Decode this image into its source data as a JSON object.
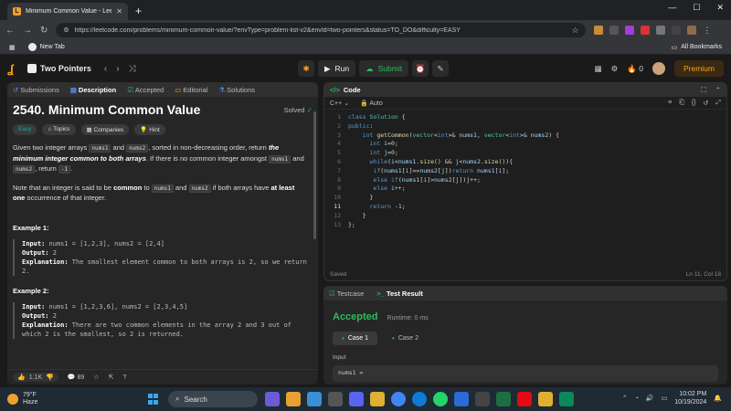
{
  "browser": {
    "tab_title": "Minimum Common Value - Lee",
    "tab_favicon": "L",
    "new_tab_glyph": "+",
    "url": "https://leetcode.com/problems/minimum-common-value/?envType=problem-list-v2&envId=two-pointers&status=TO_DO&difficulty=EASY",
    "bookmark_new_tab": "New Tab",
    "all_bookmarks": "All Bookmarks"
  },
  "lc_nav": {
    "problem_list": "Two Pointers",
    "run": "Run",
    "submit": "Submit",
    "streak": "0",
    "premium": "Premium"
  },
  "left_tabs": {
    "submissions": "Submissions",
    "description": "Description",
    "accepted": "Accepted",
    "editorial": "Editorial",
    "solutions": "Solutions"
  },
  "problem": {
    "title": "2540. Minimum Common Value",
    "solved": "Solved",
    "difficulty": "Easy",
    "chips": [
      "Topics",
      "Companies",
      "Hint"
    ],
    "desc1_a": "Given two integer arrays ",
    "desc1_code1": "nums1",
    "desc1_b": " and ",
    "desc1_code2": "nums2",
    "desc1_c": ", sorted in non-decreasing order, return ",
    "desc1_bold": "the minimum integer common",
    "desc1_d": " to both arrays",
    "desc1_e": ". If there is no common integer amongst ",
    "desc1_code3": "nums1",
    "desc1_f": " and ",
    "desc1_code4": "nums2",
    "desc1_g": ", return ",
    "desc1_code5": "-1",
    "desc1_h": ".",
    "desc2_a": "Note that an integer is said to be ",
    "desc2_bold1": "common",
    "desc2_b": " to ",
    "desc2_code1": "nums1",
    "desc2_c": " and ",
    "desc2_code2": "nums2",
    "desc2_d": " if both arrays have ",
    "desc2_bold2": "at least one",
    "desc2_e": " occurrence of that integer.",
    "examples": [
      {
        "heading": "Example 1:",
        "input": "nums1 = [1,2,3], nums2 = [2,4]",
        "output": "2",
        "explanation": "The smallest element common to both arrays is 2, so we return 2."
      },
      {
        "heading": "Example 2:",
        "input": "nums1 = [1,2,3,6], nums2 = [2,3,4,5]",
        "output": "2",
        "explanation": "There are two common elements in the array 2 and 3 out of which 2 is the smallest, so 2 is returned."
      }
    ],
    "labels": {
      "input": "Input:",
      "output": "Output:",
      "explanation": "Explanation:"
    },
    "likes": "1.1K",
    "comments": "89"
  },
  "code_panel": {
    "title": "Code",
    "language": "C++",
    "auto": "Auto",
    "saved": "Saved",
    "cursor": "Ln 11, Col 18",
    "line_numbers": [
      "1",
      "2",
      "3",
      "4",
      "5",
      "6",
      "7",
      "8",
      "9",
      "10",
      "11",
      "12",
      "13"
    ]
  },
  "test_panel": {
    "testcase": "Testcase",
    "result": "Test Result",
    "status": "Accepted",
    "runtime": "Runtime: 0 ms",
    "cases": [
      "Case 1",
      "Case 2"
    ],
    "input_label": "Input",
    "input_value": "nums1 ="
  },
  "taskbar": {
    "temp": "79°F",
    "weather": "Haze",
    "search": "Search",
    "time": "10:02 PM",
    "date": "10/19/2024"
  },
  "colors": {
    "accepted": "#2cbb5d",
    "brand": "#ffa116",
    "easy": "#00b8a3"
  }
}
